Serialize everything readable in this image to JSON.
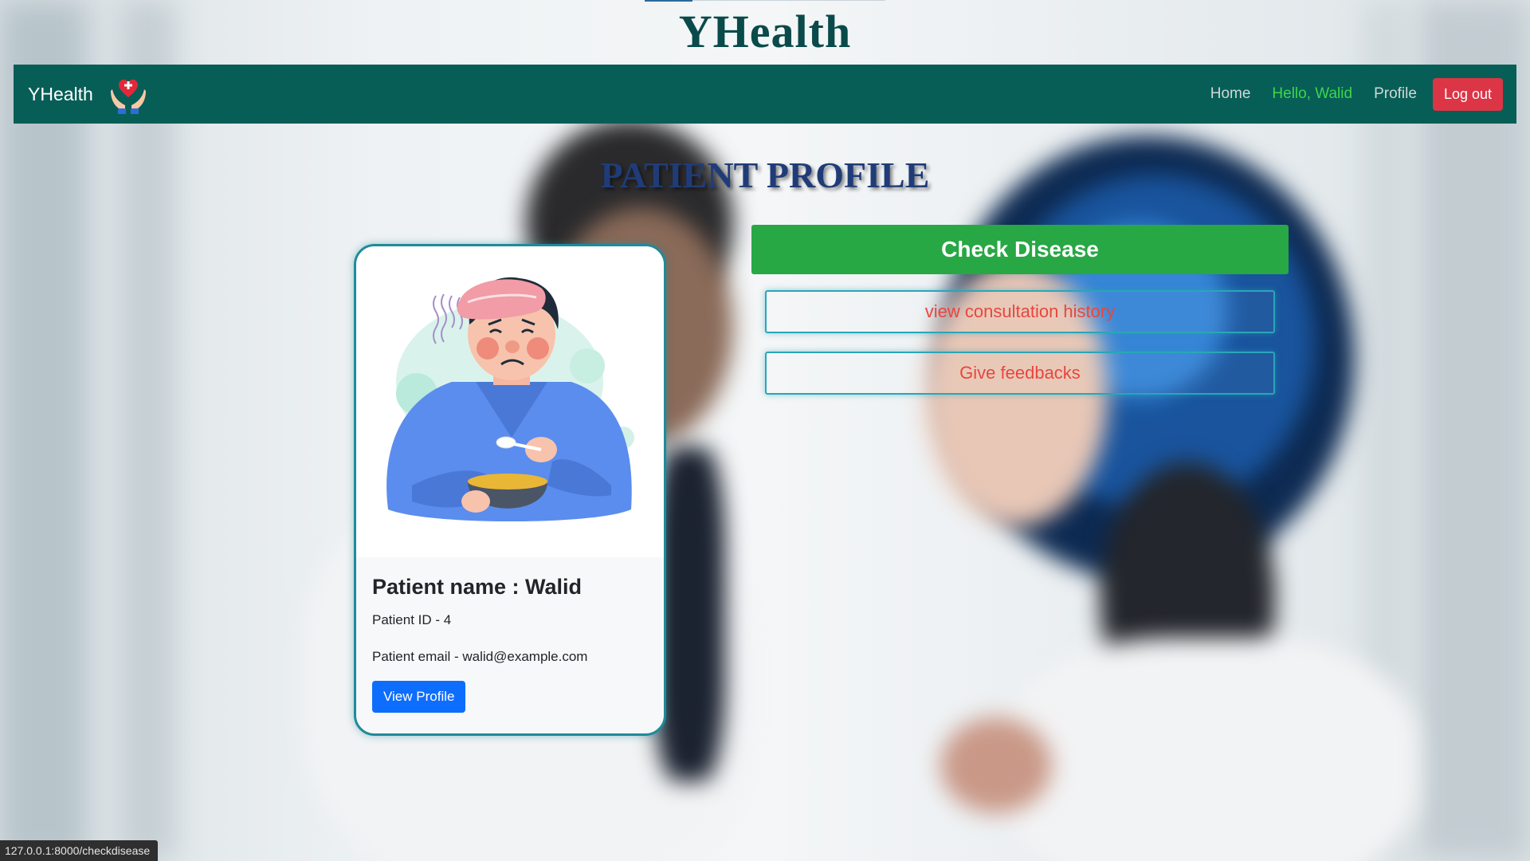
{
  "site_title": "YHealth",
  "navbar": {
    "brand": "YHealth",
    "links": {
      "home": "Home",
      "hello": "Hello, Walid",
      "profile": "Profile"
    },
    "logout_label": "Log out"
  },
  "page_heading": "PATIENT PROFILE",
  "card": {
    "name": "Patient name : Walid",
    "id": "Patient ID - 4",
    "email": "Patient email - walid@example.com",
    "view_profile_label": "View Profile"
  },
  "actions": {
    "check_disease": "Check Disease",
    "consultation_history": "view consultation history",
    "feedbacks": "Give feedbacks"
  },
  "status_url": "127.0.0.1:8000/checkdisease",
  "colors": {
    "navbar": "#075e57",
    "hello": "#3dd64a",
    "logout": "#dc3545",
    "check": "#28a745",
    "outline": "#2aa6b8",
    "outline_text": "#e8463e",
    "view_profile": "#0d6efd"
  },
  "icons": {
    "brand_logo": "hands-heart-cross-icon",
    "card_image": "sick-patient-illustration"
  }
}
